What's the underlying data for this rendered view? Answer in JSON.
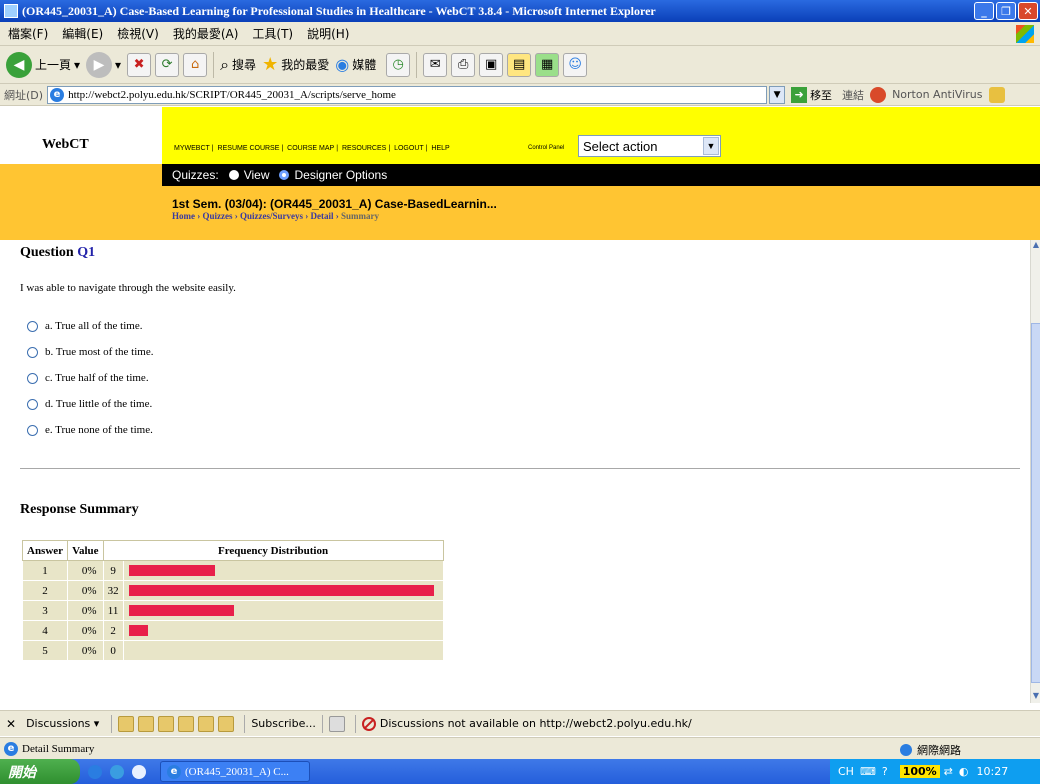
{
  "window": {
    "title": "(OR445_20031_A) Case-Based Learning for Professional Studies in Healthcare - WebCT 3.8.4 - Microsoft Internet Explorer"
  },
  "menubar": {
    "items": [
      "檔案(F)",
      "編輯(E)",
      "檢視(V)",
      "我的最愛(A)",
      "工具(T)",
      "說明(H)"
    ]
  },
  "toolbar": {
    "back_label": "上一頁",
    "search_label": "搜尋",
    "favorites_label": "我的最愛",
    "media_label": "媒體"
  },
  "addressbar": {
    "label": "網址(D)",
    "url": "http://webct2.polyu.edu.hk/SCRIPT/OR445_20031_A/scripts/serve_home",
    "go_label": "移至",
    "links_label": "連結",
    "norton_label": "Norton AntiVirus"
  },
  "webct": {
    "logo": "WebCT",
    "nav_links": [
      "MYWEBCT",
      "RESUME COURSE",
      "COURSE MAP",
      "RESOURCES",
      "LOGOUT",
      "HELP"
    ],
    "control_panel_label": "Control Panel",
    "action_select": "Select action",
    "quizbar": {
      "label": "Quizzes:",
      "view_label": "View",
      "designer_label": "Designer Options"
    },
    "course_title": "1st Sem. (03/04): (OR445_20031_A) Case-BasedLearnin...",
    "breadcrumb": [
      "Home",
      "Quizzes",
      "Quizzes/Surveys",
      "Detail"
    ],
    "breadcrumb_current": "Summary"
  },
  "question": {
    "heading_prefix": "Question",
    "number": "Q1",
    "text": "I was able to navigate through the website easily.",
    "options": [
      "a.  True all of the time.",
      "b.  True most of the time.",
      "c.  True half of the time.",
      "d.  True little of the time.",
      "e.  True none of the time."
    ]
  },
  "summary": {
    "heading": "Response Summary",
    "columns": [
      "Answer",
      "Value",
      "Frequency Distribution"
    ],
    "rows": [
      {
        "answer": "1",
        "value": "0%",
        "count": "9",
        "count_num": 9
      },
      {
        "answer": "2",
        "value": "0%",
        "count": "32",
        "count_num": 32
      },
      {
        "answer": "3",
        "value": "0%",
        "count": "11",
        "count_num": 11
      },
      {
        "answer": "4",
        "value": "0%",
        "count": "2",
        "count_num": 2
      },
      {
        "answer": "5",
        "value": "0%",
        "count": "0",
        "count_num": 0
      }
    ],
    "bar_color": "#e8204a"
  },
  "discussions": {
    "label": "Discussions ▾",
    "subscribe_label": "Subscribe...",
    "message": "Discussions not available on http://webct2.polyu.edu.hk/"
  },
  "statusbar": {
    "text": "Detail Summary",
    "zone": "網際網路"
  },
  "taskbar": {
    "start_label": "開始",
    "task_label": "(OR445_20031_A) C...",
    "tray_lang": "CH",
    "tray_zoom": "100%",
    "clock": "10:27"
  }
}
